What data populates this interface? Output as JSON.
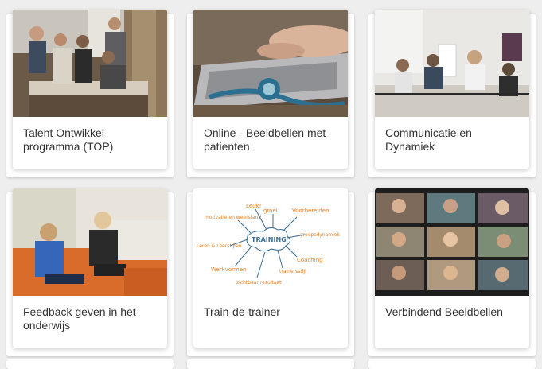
{
  "cards": [
    {
      "title": "Talent Ontwikkel-programma (TOP)",
      "image": "team-meeting-photo"
    },
    {
      "title": "Online - Beeldbellen met patienten",
      "image": "laptop-stethoscope-photo"
    },
    {
      "title": "Communicatie en Dynamiek",
      "image": "group-training-photo"
    },
    {
      "title": "Feedback geven in het onderwijs",
      "image": "two-women-talking-photo"
    },
    {
      "title": "Train-de-trainer",
      "image": "mindmap-sketch"
    },
    {
      "title": "Verbindend Beeldbellen",
      "image": "video-call-grid-photo"
    }
  ],
  "mindmap": {
    "center": "TRAINING",
    "branches": [
      "Leuk!",
      "groei",
      "Voorbereiden",
      "groepsdynamiek",
      "Coaching",
      "trainersstijl",
      "zichtbaar resultaat",
      "Werkvormen",
      "Leren & Leerstijlen",
      "motivatie en weerstand"
    ]
  },
  "colors": {
    "background": "#eeeeee",
    "card": "#ffffff",
    "title": "#333333",
    "sketch_orange": "#e67e22",
    "sketch_blue": "#3b6f94"
  }
}
